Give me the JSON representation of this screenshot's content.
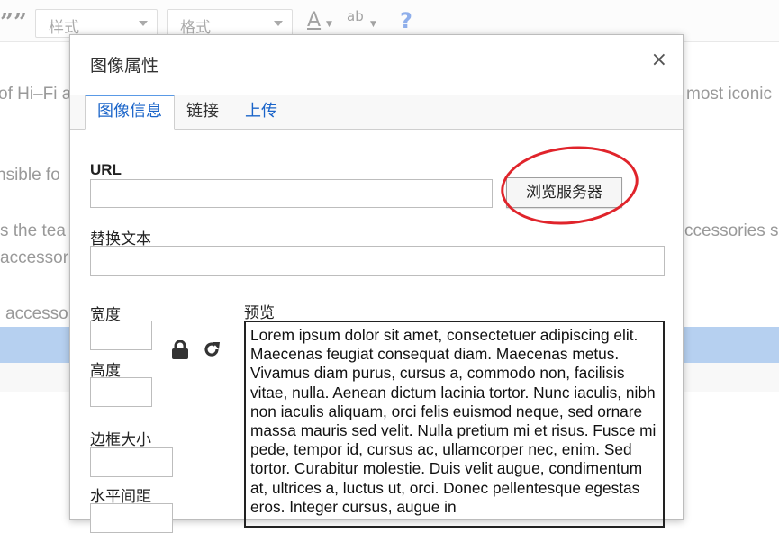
{
  "editor": {
    "toolbar": {
      "quote_icon": "blockquote-icon",
      "style_select": "样式",
      "format_select": "格式",
      "text_color_icon": "A",
      "bg_color_icon": "ab",
      "help_icon": "?"
    },
    "content_fragments": [
      "of Hi–Fi a",
      "most iconic",
      "nsible fo",
      "s the tea",
      "ccessories s",
      "accessor",
      "accesso"
    ]
  },
  "dialog": {
    "title": "图像属性",
    "close": "×",
    "tabs": [
      {
        "label": "图像信息",
        "active": true
      },
      {
        "label": "链接",
        "active": false
      },
      {
        "label": "上传",
        "active": false
      }
    ],
    "url_label": "URL",
    "url_value": "",
    "browse_button": "浏览服务器",
    "alt_label": "替换文本",
    "alt_value": "",
    "width_label": "宽度",
    "height_label": "高度",
    "border_label": "边框大小",
    "hspace_label": "水平间距",
    "preview_label": "预览",
    "preview_text": "Lorem ipsum dolor sit amet, consectetuer adipiscing elit. Maecenas feugiat consequat diam. Maecenas metus. Vivamus diam purus, cursus a, commodo non, facilisis vitae, nulla. Aenean dictum lacinia tortor. Nunc iaculis, nibh non iaculis aliquam, orci felis euismod neque, sed ornare massa mauris sed velit. Nulla pretium mi et risus. Fusce mi pede, tempor id, cursus ac, ullamcorper nec, enim. Sed tortor. Curabitur molestie. Duis velit augue, condimentum at, ultrices a, luctus ut, orci. Donec pellentesque egestas eros. Integer cursus, augue in"
  },
  "colors": {
    "highlight_circle": "#e0242b",
    "tab_accent": "#5a9ae6",
    "link_blue": "#1a64c9"
  }
}
